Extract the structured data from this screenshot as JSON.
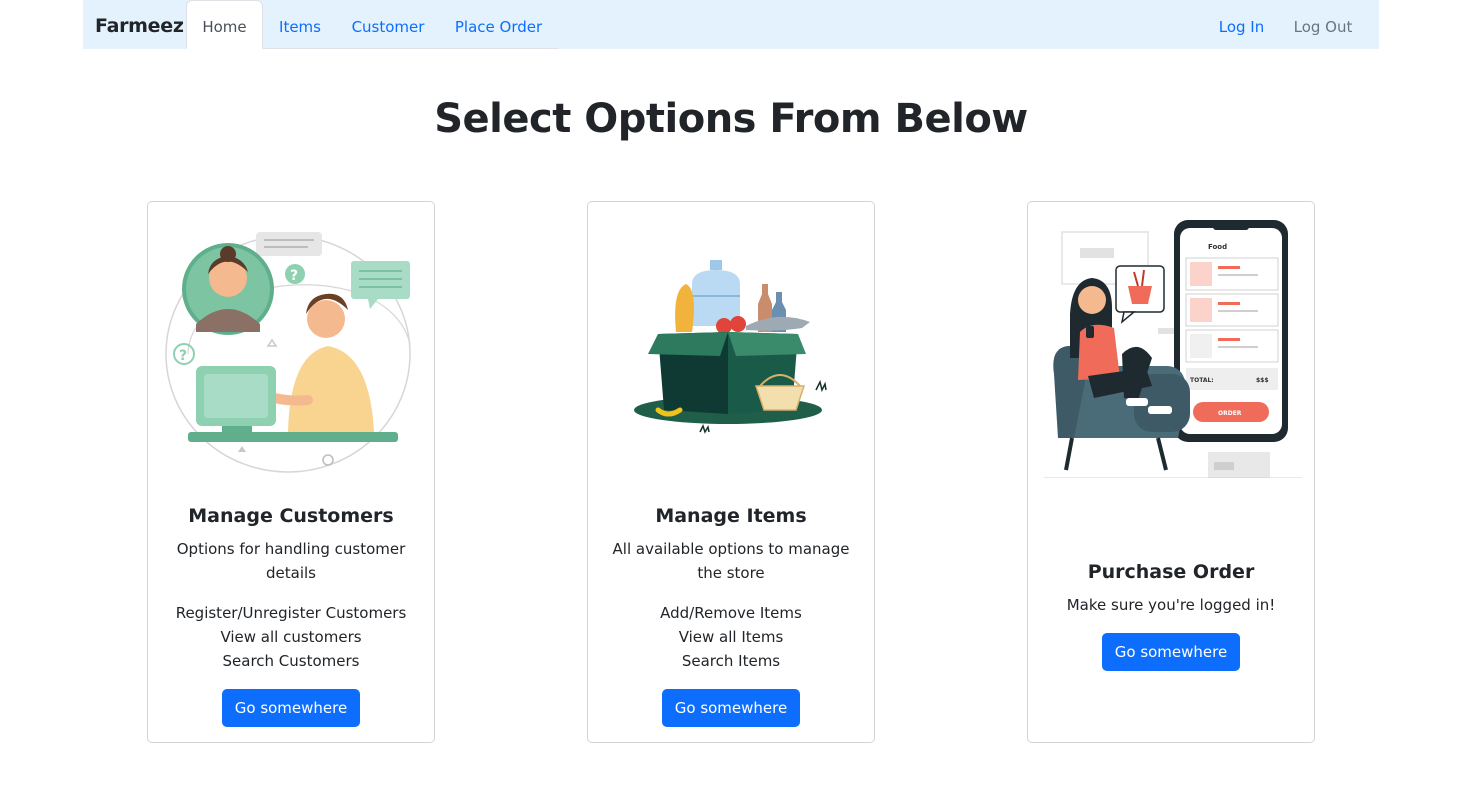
{
  "navbar": {
    "brand": "Farmeez",
    "links": [
      {
        "label": "Home"
      },
      {
        "label": "Items"
      },
      {
        "label": "Customer"
      },
      {
        "label": "Place Order"
      }
    ],
    "right_links": [
      {
        "label": "Log In"
      },
      {
        "label": "Log Out"
      }
    ]
  },
  "main": {
    "title": "Select Options From Below"
  },
  "cards": [
    {
      "title": "Manage Customers",
      "text": "Options for handling customer details",
      "items": [
        "Register/Unregister Customers",
        "View all customers",
        "Search Customers"
      ],
      "button": "Go somewhere"
    },
    {
      "title": "Manage Items",
      "text": "All available options to manage the store",
      "items": [
        "Add/Remove Items",
        "View all Items",
        "Search Items"
      ],
      "button": "Go somewhere"
    },
    {
      "title": "Purchase Order",
      "text": "Make sure you're logged in!",
      "button": "Go somewhere"
    }
  ],
  "illustration_labels": {
    "phone_title": "Food",
    "total_label": "TOTAL:",
    "total_value": "$$$",
    "order_button": "ORDER"
  },
  "colors": {
    "navbar_bg": "#e3f2fd",
    "link": "#0d6efd",
    "primary_button": "#0d6efd",
    "accent_green": "#5fae8c",
    "accent_red": "#f06b5a"
  }
}
